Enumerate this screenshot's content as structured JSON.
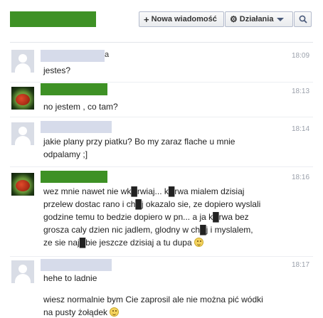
{
  "header": {
    "new_message_label": "Nowa wiadomość",
    "actions_label": "Działania",
    "search_icon": "search-icon"
  },
  "colors": {
    "redaction_green": "#3e9125",
    "redaction_gray": "#d6dbea"
  },
  "messages": [
    {
      "name_suffix": "a",
      "time": "18:09",
      "lines": [
        "jestes?"
      ]
    },
    {
      "name_suffix": "",
      "time": "18:13",
      "lines": [
        "no jestem , co tam?"
      ]
    },
    {
      "name_suffix": "",
      "time": "18:14",
      "lines": [
        "jakie plany przy piatku? Bo my zaraz flache u mnie",
        "odpalamy ;]"
      ]
    },
    {
      "name_suffix": "",
      "time": "18:16",
      "lines": [
        "wez mnie nawet nie wk█rwiaj... k█rwa mialem dzisiaj",
        "przelew dostac rano i ch█j okazalo sie, ze dopiero wyslali",
        "godzine temu to bedzie dopiero w pn... a ja k█rwa bez",
        "grosza caly dzien nic jadlem, glodny w ch█j i myslalem,",
        "ze sie naj█bie jeszcze dzisiaj a tu dupa"
      ]
    },
    {
      "name_suffix": "",
      "time": "18:17",
      "lines": [
        "hehe to ladnie",
        "",
        "wiesz normalnie bym Cie zaprosil ale nie można pić wódki",
        "na pusty żołądek"
      ]
    }
  ]
}
